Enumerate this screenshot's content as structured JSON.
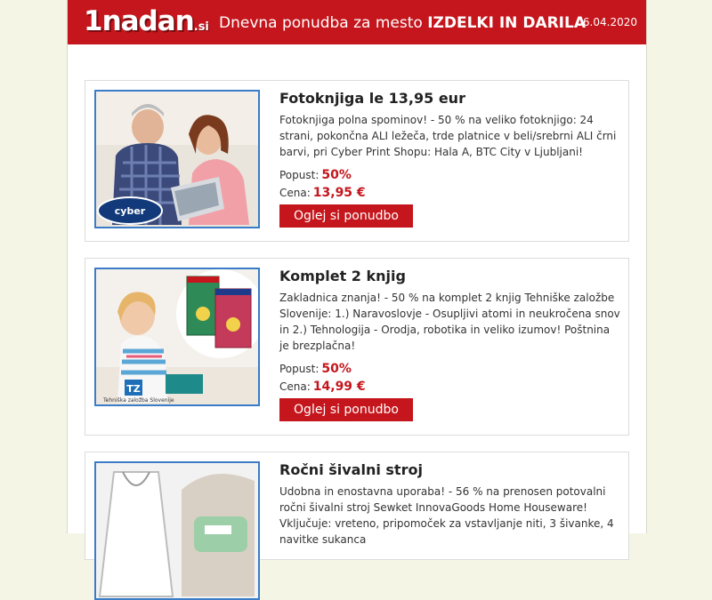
{
  "header": {
    "logo": "1nadan",
    "logo_tld": ".si",
    "title_prefix": "Dnevna ponudba za mesto",
    "title_city": "IZDELKI IN DARILA",
    "date": "06.04.2020"
  },
  "labels": {
    "discount": "Popust:",
    "price": "Cena:"
  },
  "offers": [
    {
      "title": "Fotoknjiga le 13,95 eur",
      "description": "Fotoknjiga polna spominov! - 50 % na veliko fotoknjigo: 24 strani, pokončna ALI ležeča, trde platnice v beli/srebrni ALI črni barvi, pri Cyber Print Shopu: Hala A, BTC City v Ljubljani!",
      "discount": "50%",
      "price": "13,95 €",
      "button": "Oglej si ponudbo",
      "image_brand": "cyber"
    },
    {
      "title": "Komplet 2 knjig",
      "description": "Zakladnica znanja! - 50 % na komplet 2 knjig Tehniške založbe Slovenije: 1.) Naravoslovje - Osupljivi atomi in neukročena snov in 2.) Tehnologija - Orodja, robotika in veliko izumov! Poštnina je brezplačna!",
      "discount": "50%",
      "price": "14,99 €",
      "button": "Oglej si ponudbo",
      "image_brand": "Tehniška založba Slovenije"
    },
    {
      "title": "Ročni šivalni stroj",
      "description": "Udobna in enostavna uporaba! - 56 % na prenosen potovalni ročni šivalni stroj Sewket InnovaGoods Home Houseware! Vključuje: vreteno, pripomoček za vstavljanje niti, 3 šivanke, 4 navitke sukanca"
    }
  ],
  "colors": {
    "brand_red": "#c4161c",
    "thumb_border": "#3a7cc7"
  }
}
